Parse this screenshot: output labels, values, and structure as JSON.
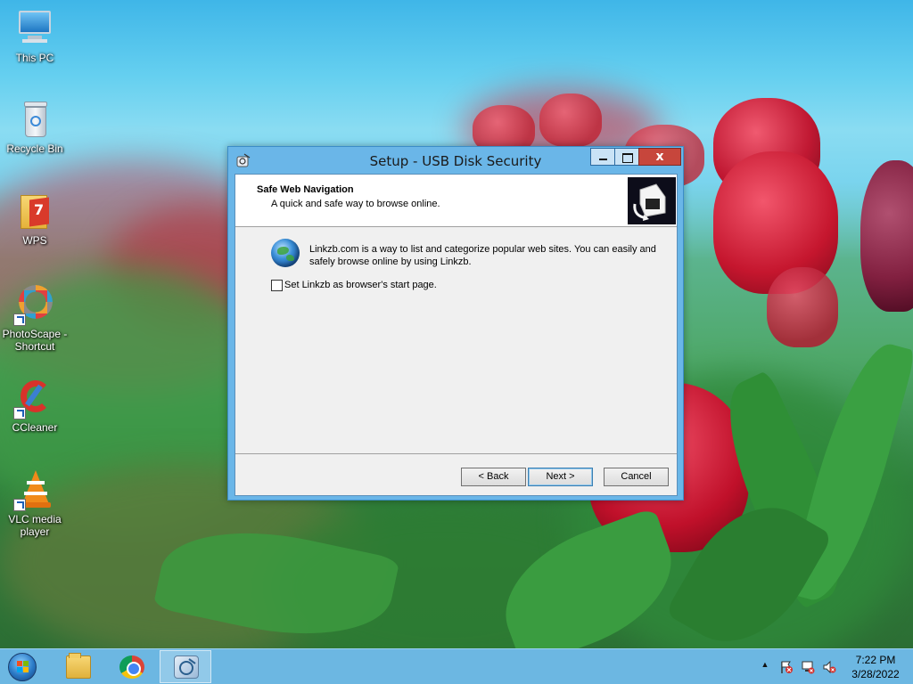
{
  "desktop": {
    "icons": [
      {
        "label": "This PC",
        "icon": "computer-icon"
      },
      {
        "label": "Recycle Bin",
        "icon": "recycle-bin-icon"
      },
      {
        "label": "WPS",
        "icon": "wps-icon"
      },
      {
        "label": "PhotoScape - Shortcut",
        "icon": "photoscape-icon"
      },
      {
        "label": "CCleaner",
        "icon": "ccleaner-icon"
      },
      {
        "label": "VLC media player",
        "icon": "vlc-icon"
      }
    ]
  },
  "window": {
    "title": "Setup - USB Disk Security",
    "close_glyph": "x",
    "header": {
      "title": "Safe Web Navigation",
      "subtitle": "A quick and safe way to browse online."
    },
    "description": "Linkzb.com is a way to list and categorize popular web sites. You can easily and safely browse online by using Linkzb.",
    "checkbox": {
      "label": "Set Linkzb as browser's start page.",
      "checked": false
    },
    "buttons": {
      "back": "< Back",
      "next": "Next >",
      "cancel": "Cancel"
    }
  },
  "taskbar": {
    "apps": [
      {
        "name": "file-explorer",
        "icon": "folder-icon"
      },
      {
        "name": "chrome",
        "icon": "chrome-icon"
      },
      {
        "name": "usb-disk-security-setup",
        "icon": "usb-disk-security-icon",
        "active": true
      }
    ],
    "tray": {
      "show_hidden": "▲",
      "time": "7:22 PM",
      "date": "3/28/2022"
    }
  },
  "colors": {
    "titlebar": "#6ab6e8",
    "close_button": "#c7463c",
    "taskbar": "#6cb7e2",
    "dialog_body": "#f0f0f0"
  }
}
